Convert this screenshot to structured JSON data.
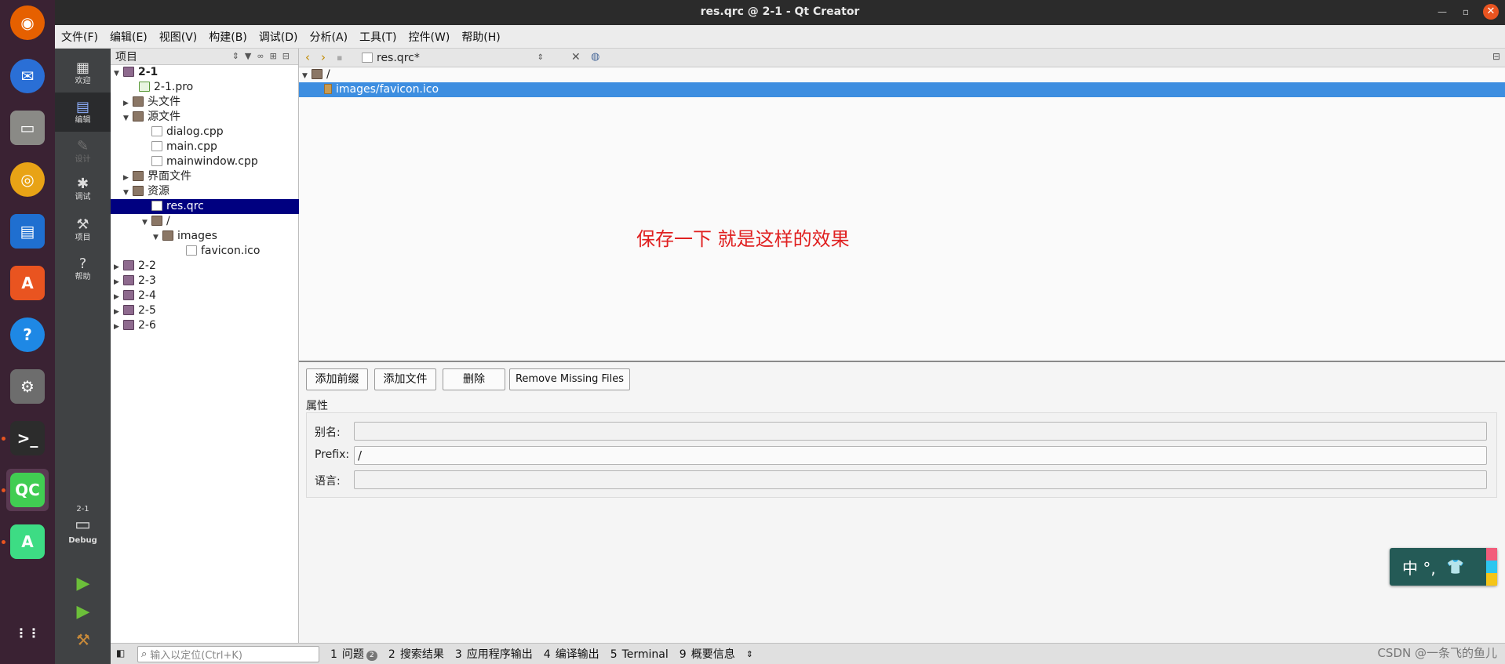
{
  "window": {
    "title": "res.qrc @ 2-1 - Qt Creator",
    "minimize_icon": "minimize-icon",
    "maximize_icon": "maximize-icon",
    "close_glyph": "✕"
  },
  "menu": [
    "文件(F)",
    "编辑(E)",
    "视图(V)",
    "构建(B)",
    "调试(D)",
    "分析(A)",
    "工具(T)",
    "控件(W)",
    "帮助(H)"
  ],
  "modes": [
    {
      "label": "欢迎",
      "icon": "grid-icon",
      "glyph": "▦"
    },
    {
      "label": "编辑",
      "icon": "edit-icon",
      "glyph": "▤"
    },
    {
      "label": "设计",
      "icon": "pencil-icon",
      "glyph": "✎"
    },
    {
      "label": "调试",
      "icon": "bug-icon",
      "glyph": "✱"
    },
    {
      "label": "项目",
      "icon": "wrench-icon",
      "glyph": "⚒"
    },
    {
      "label": "帮助",
      "icon": "help-icon",
      "glyph": "?"
    }
  ],
  "kit": {
    "project": "2-1",
    "config": "Debug"
  },
  "sidebar": {
    "title": "项目",
    "tree": [
      {
        "label": "2-1",
        "arrow": "▼",
        "icon": "project",
        "bold": true
      },
      {
        "label": "2-1.pro",
        "arrow": "",
        "icon": "pro"
      },
      {
        "label": "头文件",
        "arrow": "▶",
        "icon": "folder"
      },
      {
        "label": "源文件",
        "arrow": "▼",
        "icon": "folder"
      },
      {
        "label": "dialog.cpp",
        "arrow": "",
        "icon": "doc"
      },
      {
        "label": "main.cpp",
        "arrow": "",
        "icon": "doc"
      },
      {
        "label": "mainwindow.cpp",
        "arrow": "",
        "icon": "doc"
      },
      {
        "label": "界面文件",
        "arrow": "▶",
        "icon": "folder"
      },
      {
        "label": "资源",
        "arrow": "▼",
        "icon": "folder"
      },
      {
        "label": "res.qrc",
        "arrow": "",
        "icon": "doc",
        "selected": true
      },
      {
        "label": "/",
        "arrow": "▼",
        "icon": "folder"
      },
      {
        "label": "images",
        "arrow": "▼",
        "icon": "folder"
      },
      {
        "label": "favicon.ico",
        "arrow": "",
        "icon": "doc"
      },
      {
        "label": "2-2",
        "arrow": "▶",
        "icon": "project"
      },
      {
        "label": "2-3",
        "arrow": "▶",
        "icon": "project"
      },
      {
        "label": "2-4",
        "arrow": "▶",
        "icon": "project"
      },
      {
        "label": "2-5",
        "arrow": "▶",
        "icon": "project"
      },
      {
        "label": "2-6",
        "arrow": "▶",
        "icon": "project"
      }
    ]
  },
  "editor": {
    "document": "res.qrc*",
    "resource_tree": [
      {
        "label": "/",
        "arrow": "▼"
      },
      {
        "label": "images/favicon.ico",
        "arrow": "",
        "selected": true
      }
    ],
    "annotation": "保存一下 就是这样的效果"
  },
  "buttons": {
    "add_prefix": "添加前缀",
    "add_files": "添加文件",
    "remove": "删除",
    "remove_missing": "Remove Missing Files"
  },
  "properties": {
    "title": "属性",
    "alias_label": "别名:",
    "alias_value": "",
    "prefix_label": "Prefix:",
    "prefix_value": "/",
    "language_label": "语言:",
    "language_value": ""
  },
  "statusbar": {
    "locator_placeholder": "输入以定位(Ctrl+K)",
    "panes": [
      {
        "num": "1",
        "label": "问题",
        "badge": "2"
      },
      {
        "num": "2",
        "label": "搜索结果"
      },
      {
        "num": "3",
        "label": "应用程序输出"
      },
      {
        "num": "4",
        "label": "编译输出"
      },
      {
        "num": "5",
        "label": "Terminal"
      },
      {
        "num": "9",
        "label": "概要信息"
      }
    ]
  },
  "ime": {
    "text": "中 °, ",
    "icon": "shirt-icon"
  },
  "watermark": "CSDN @一条飞的鱼儿",
  "dock": [
    {
      "name": "firefox",
      "color": "#e66000",
      "glyph": "◉"
    },
    {
      "name": "thunderbird",
      "color": "#2a6fd6",
      "glyph": "✉"
    },
    {
      "name": "files",
      "color": "#8a8a86",
      "glyph": "▭"
    },
    {
      "name": "rhythmbox",
      "color": "#e8a316",
      "glyph": "◎"
    },
    {
      "name": "writer",
      "color": "#1f6fd0",
      "glyph": "▤"
    },
    {
      "name": "app-center",
      "color": "#e95420",
      "glyph": "A"
    },
    {
      "name": "help",
      "color": "#1e88e5",
      "glyph": "?"
    },
    {
      "name": "settings",
      "color": "#6d6d6d",
      "glyph": "⚙"
    },
    {
      "name": "terminal",
      "color": "#2c2c2c",
      "glyph": ">_"
    },
    {
      "name": "qt-creator",
      "color": "#41cd52",
      "glyph": "QC"
    },
    {
      "name": "android-studio",
      "color": "#3ddc84",
      "glyph": "A"
    },
    {
      "name": "show-apps",
      "color": "#3a2233",
      "glyph": "⋮⋮"
    }
  ]
}
